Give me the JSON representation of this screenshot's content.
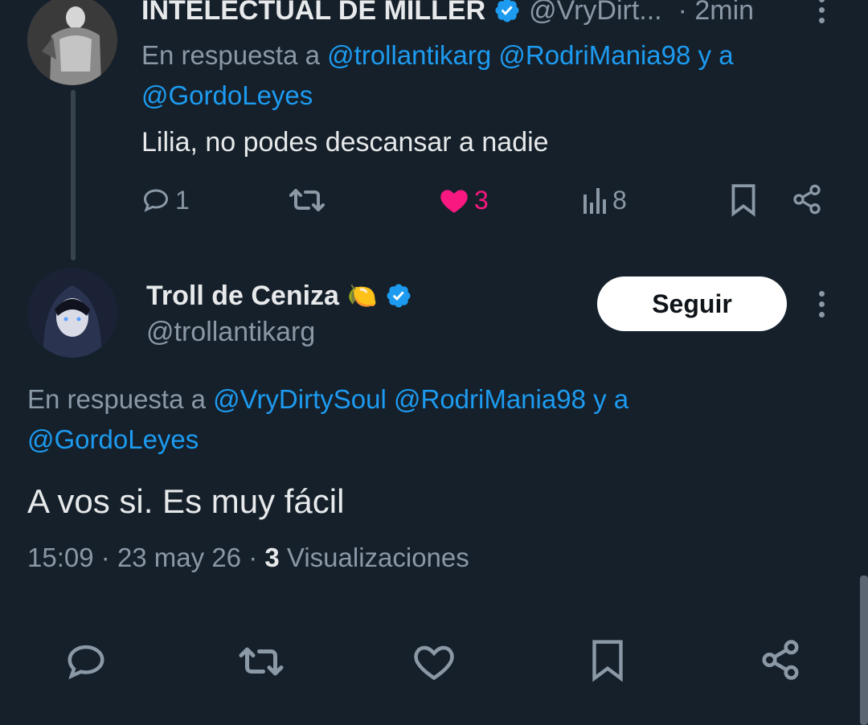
{
  "parent_tweet": {
    "author_name": "INTELECTUAL DE MILLER",
    "handle": "@VryDirt...",
    "time": "· 2min",
    "reply_prefix": "En respuesta a",
    "reply_mention_1": "@trollantikarg",
    "reply_mention_2": "@RodriMania98",
    "reply_joiner": "y a",
    "reply_mention_3": "@GordoLeyes",
    "text": "Lilia, no podes descansar a nadie",
    "replies": "1",
    "likes": "3",
    "views": "8",
    "like_color": "#f91880"
  },
  "main_tweet": {
    "author_name": "Troll de Ceniza",
    "emoji": "🍋",
    "handle": "@trollantikarg",
    "follow_label": "Seguir",
    "reply_prefix": "En respuesta a",
    "reply_mention_1": "@VryDirtySoul",
    "reply_mention_2": "@RodriMania98",
    "reply_joiner": "y a",
    "reply_mention_3": "@GordoLeyes",
    "text": "A vos si. Es muy fácil",
    "time": "15:09",
    "date": "23 may 26",
    "views_count": "3",
    "views_label": "Visualizaciones"
  },
  "colors": {
    "background": "#15202b",
    "accent": "#1d9bf0",
    "muted": "#8b98a5"
  }
}
